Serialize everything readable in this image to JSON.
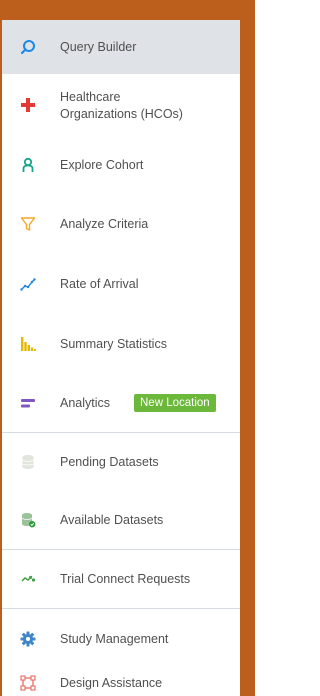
{
  "colors": {
    "frame": "#bd5f1c",
    "active_bg": "#dfe3e8",
    "badge_bg": "#6bb83a"
  },
  "nav": {
    "items": [
      {
        "id": "query-builder",
        "label": "Query Builder",
        "icon": "search-icon",
        "active": true
      },
      {
        "id": "hcos",
        "label_line1": "Healthcare",
        "label_line2": "Organizations (HCOs)",
        "icon": "plus-cross-icon"
      },
      {
        "id": "explore-cohort",
        "label": "Explore Cohort",
        "icon": "person-icon"
      },
      {
        "id": "analyze-criteria",
        "label": "Analyze Criteria",
        "icon": "filter-icon"
      },
      {
        "id": "rate-of-arrival",
        "label": "Rate of Arrival",
        "icon": "trend-line-icon"
      },
      {
        "id": "summary-statistics",
        "label": "Summary Statistics",
        "icon": "bar-chart-icon"
      },
      {
        "id": "analytics",
        "label": "Analytics",
        "badge": "New Location",
        "icon": "analytics-bars-icon"
      },
      {
        "id": "pending-datasets",
        "label": "Pending Datasets",
        "icon": "database-icon"
      },
      {
        "id": "available-datasets",
        "label": "Available Datasets",
        "icon": "database-check-icon"
      },
      {
        "id": "trial-connect",
        "label": "Trial Connect Requests",
        "icon": "connect-icon"
      },
      {
        "id": "study-management",
        "label": "Study Management",
        "icon": "gear-icon"
      },
      {
        "id": "design-assistance",
        "label": "Design Assistance",
        "icon": "design-frame-icon"
      }
    ]
  }
}
